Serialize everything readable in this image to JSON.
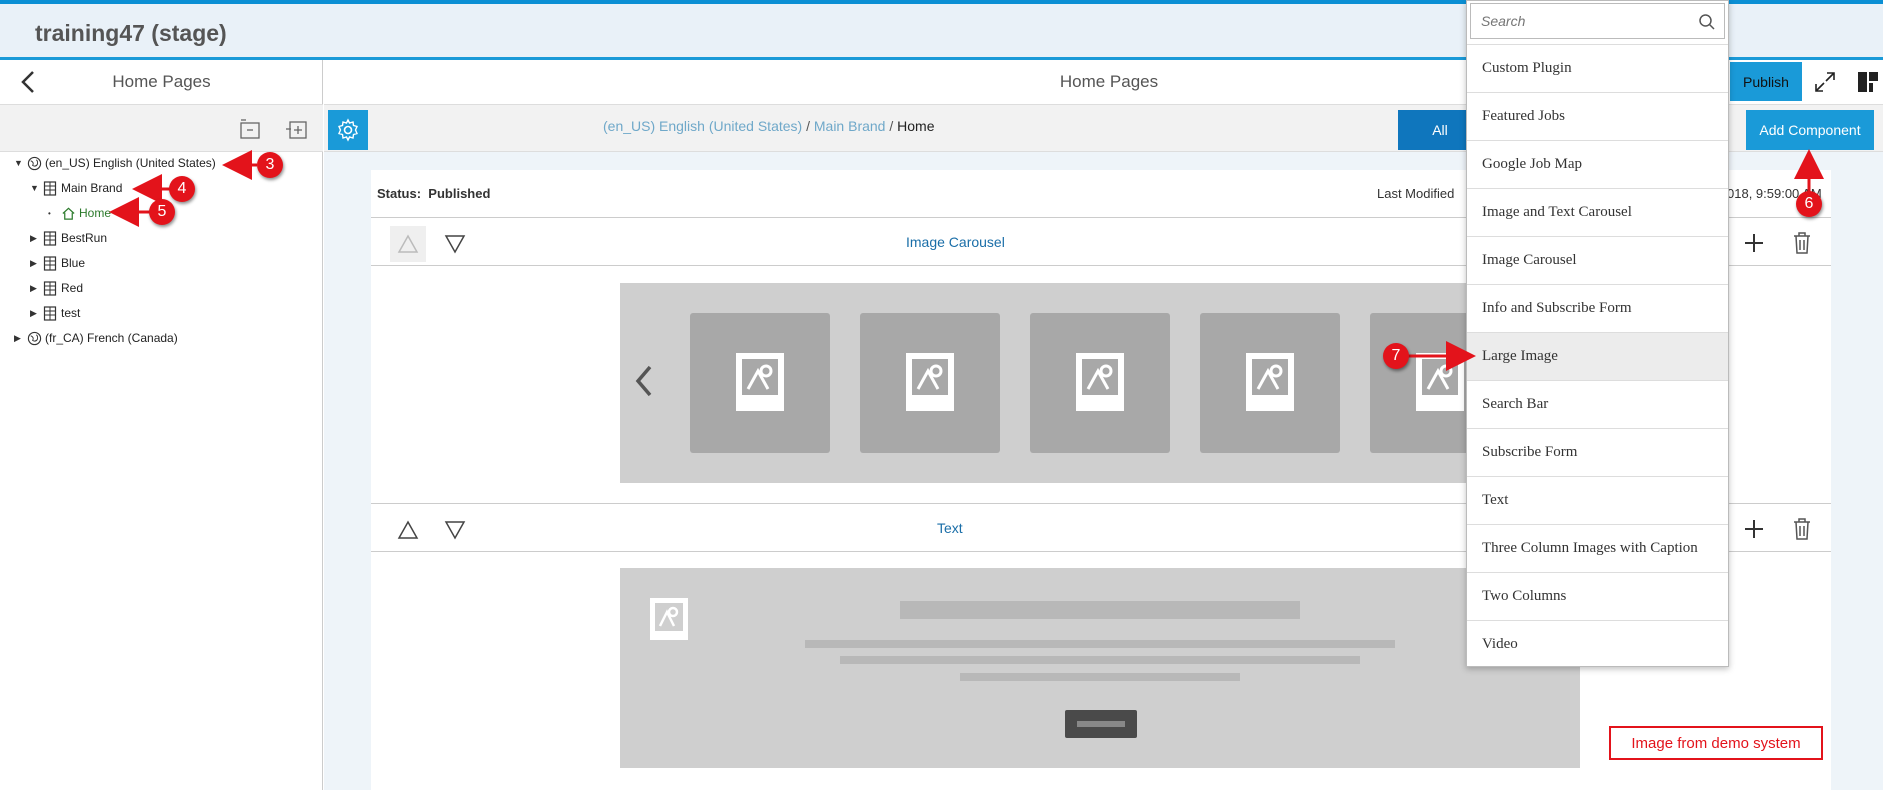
{
  "app": {
    "title": "training47 (stage)"
  },
  "left_pane": {
    "header": "Home Pages",
    "tree": [
      {
        "label": "(en_US) English (United States)"
      },
      {
        "label": "Main Brand"
      },
      {
        "label": "Home"
      },
      {
        "label": "BestRun"
      },
      {
        "label": "Blue"
      },
      {
        "label": "Red"
      },
      {
        "label": "test"
      },
      {
        "label": "(fr_CA) French (Canada)"
      }
    ]
  },
  "main": {
    "header": "Home Pages",
    "publish_label": "Publish",
    "breadcrumb": {
      "locale": "(en_US) English (United States)",
      "brand": "Main Brand",
      "page": "Home",
      "sep": "/"
    },
    "all_label": "All",
    "add_component_label": "Add Component",
    "status_label": "Status:",
    "status_value": "Published",
    "last_modified_label": "Last Modified",
    "last_modified_tail": "018, 9:59:00 AM",
    "components": [
      {
        "title": "Image Carousel"
      },
      {
        "title": "Text"
      }
    ]
  },
  "dropdown": {
    "search_placeholder": "Search",
    "items": [
      "Custom Plugin",
      "Featured Jobs",
      "Google Job Map",
      "Image and Text Carousel",
      "Image Carousel",
      "Info and Subscribe Form",
      "Large Image",
      "Search Bar",
      "Subscribe Form",
      "Text",
      "Three Column Images with Caption",
      "Two Columns",
      "Video"
    ],
    "highlighted": "Large Image"
  },
  "annotations": {
    "markers": [
      "3",
      "4",
      "5",
      "6",
      "7"
    ],
    "note": "Image from demo system"
  },
  "colors": {
    "accent": "#1a9ad8",
    "marker": "#e3131b",
    "link": "#1a6ea8"
  }
}
